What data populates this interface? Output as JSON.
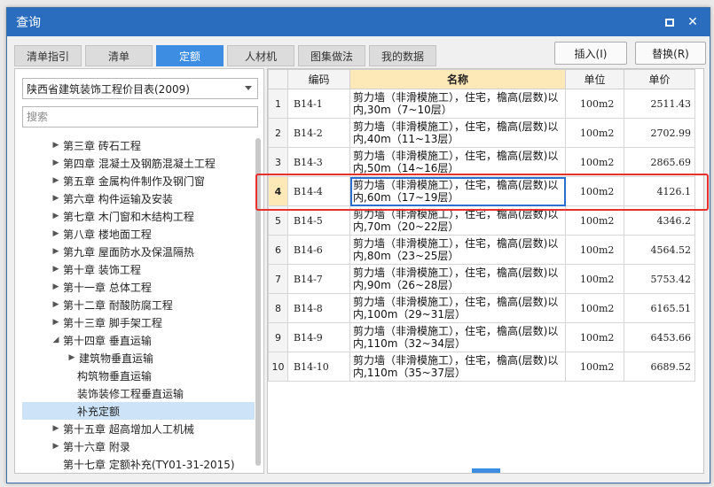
{
  "window": {
    "title": "查询",
    "maximize_icon": "maximize-icon",
    "close_icon": "close-icon",
    "close_glyph": "✕"
  },
  "tabs": [
    {
      "label": "清单指引",
      "active": false
    },
    {
      "label": "清单",
      "active": false
    },
    {
      "label": "定额",
      "active": true
    },
    {
      "label": "人材机",
      "active": false
    },
    {
      "label": "图集做法",
      "active": false
    },
    {
      "label": "我的数据",
      "active": false
    }
  ],
  "buttons": {
    "insert": "插入(I)",
    "replace": "替换(R)"
  },
  "left": {
    "library_select": "陕西省建筑装饰工程价目表(2009)",
    "search_placeholder": "搜索",
    "tree": [
      {
        "label": "第三章 砖石工程",
        "level": 1,
        "arrow": "▶"
      },
      {
        "label": "第四章 混凝土及钢筋混凝土工程",
        "level": 1,
        "arrow": "▶"
      },
      {
        "label": "第五章 金属构件制作及钢门窗",
        "level": 1,
        "arrow": "▶"
      },
      {
        "label": "第六章 构件运输及安装",
        "level": 1,
        "arrow": "▶"
      },
      {
        "label": "第七章 木门窗和木结构工程",
        "level": 1,
        "arrow": "▶"
      },
      {
        "label": "第八章 楼地面工程",
        "level": 1,
        "arrow": "▶"
      },
      {
        "label": "第九章 屋面防水及保温隔热",
        "level": 1,
        "arrow": "▶"
      },
      {
        "label": "第十章 装饰工程",
        "level": 1,
        "arrow": "▶"
      },
      {
        "label": "第十一章 总体工程",
        "level": 1,
        "arrow": "▶"
      },
      {
        "label": "第十二章 耐酸防腐工程",
        "level": 1,
        "arrow": "▶"
      },
      {
        "label": "第十三章 脚手架工程",
        "level": 1,
        "arrow": "▶"
      },
      {
        "label": "第十四章 垂直运输",
        "level": 1,
        "arrow": "◢"
      },
      {
        "label": "建筑物垂直运输",
        "level": 2,
        "arrow": "▶"
      },
      {
        "label": "构筑物垂直运输",
        "level": 3,
        "arrow": ""
      },
      {
        "label": "装饰装修工程垂直运输",
        "level": 3,
        "arrow": ""
      },
      {
        "label": "补充定额",
        "level": 3,
        "arrow": "",
        "selected": true
      },
      {
        "label": "第十五章 超高增加人工机械",
        "level": 1,
        "arrow": "▶"
      },
      {
        "label": "第十六章 附录",
        "level": 1,
        "arrow": "▶"
      },
      {
        "label": "第十七章 定额补充(TY01-31-2015)",
        "level": 1,
        "arrow": ""
      }
    ]
  },
  "table": {
    "headers": [
      "",
      "编码",
      "名称",
      "单位",
      "单价"
    ],
    "rows": [
      {
        "no": "1",
        "code": "B14-1",
        "name1": "剪力墙（非滑模施工），住宅，檐高(层数)以",
        "name2": "内,30m（7~10层）",
        "unit": "100m2",
        "price": "2511.43"
      },
      {
        "no": "2",
        "code": "B14-2",
        "name1": "剪力墙（非滑模施工），住宅，檐高(层数)以",
        "name2": "内,40m（11~13层）",
        "unit": "100m2",
        "price": "2702.99"
      },
      {
        "no": "3",
        "code": "B14-3",
        "name1": "剪力墙（非滑模施工），住宅，檐高(层数)以",
        "name2": "内,50m（14~16层）",
        "unit": "100m2",
        "price": "2865.69"
      },
      {
        "no": "4",
        "code": "B14-4",
        "name1": "剪力墙（非滑模施工），住宅，檐高(层数)以",
        "name2": "内,60m（17~19层）",
        "unit": "100m2",
        "price": "4126.1",
        "selected": true
      },
      {
        "no": "5",
        "code": "B14-5",
        "name1": "剪力墙（非滑模施工），住宅，檐高(层数)以",
        "name2": "内,70m（20~22层）",
        "unit": "100m2",
        "price": "4346.2"
      },
      {
        "no": "6",
        "code": "B14-6",
        "name1": "剪力墙（非滑模施工），住宅，檐高(层数)以",
        "name2": "内,80m（23~25层）",
        "unit": "100m2",
        "price": "4564.52"
      },
      {
        "no": "7",
        "code": "B14-7",
        "name1": "剪力墙（非滑模施工），住宅，檐高(层数)以",
        "name2": "内,90m（26~28层）",
        "unit": "100m2",
        "price": "5753.42"
      },
      {
        "no": "8",
        "code": "B14-8",
        "name1": "剪力墙（非滑模施工），住宅，檐高(层数)以",
        "name2": "内,100m（29~31层）",
        "unit": "100m2",
        "price": "6165.51"
      },
      {
        "no": "9",
        "code": "B14-9",
        "name1": "剪力墙（非滑模施工），住宅，檐高(层数)以",
        "name2": "内,110m（32~34层）",
        "unit": "100m2",
        "price": "6453.66"
      },
      {
        "no": "10",
        "code": "B14-10",
        "name1": "剪力墙（非滑模施工），住宅，檐高(层数)以",
        "name2": "内,110m（35~37层）",
        "unit": "100m2",
        "price": "6689.52"
      }
    ]
  },
  "colors": {
    "titlebar": "#2a6cbd",
    "active_tab": "#3d8ee3",
    "highlight_box": "#e8302c",
    "header_name": "#fde8b8"
  }
}
